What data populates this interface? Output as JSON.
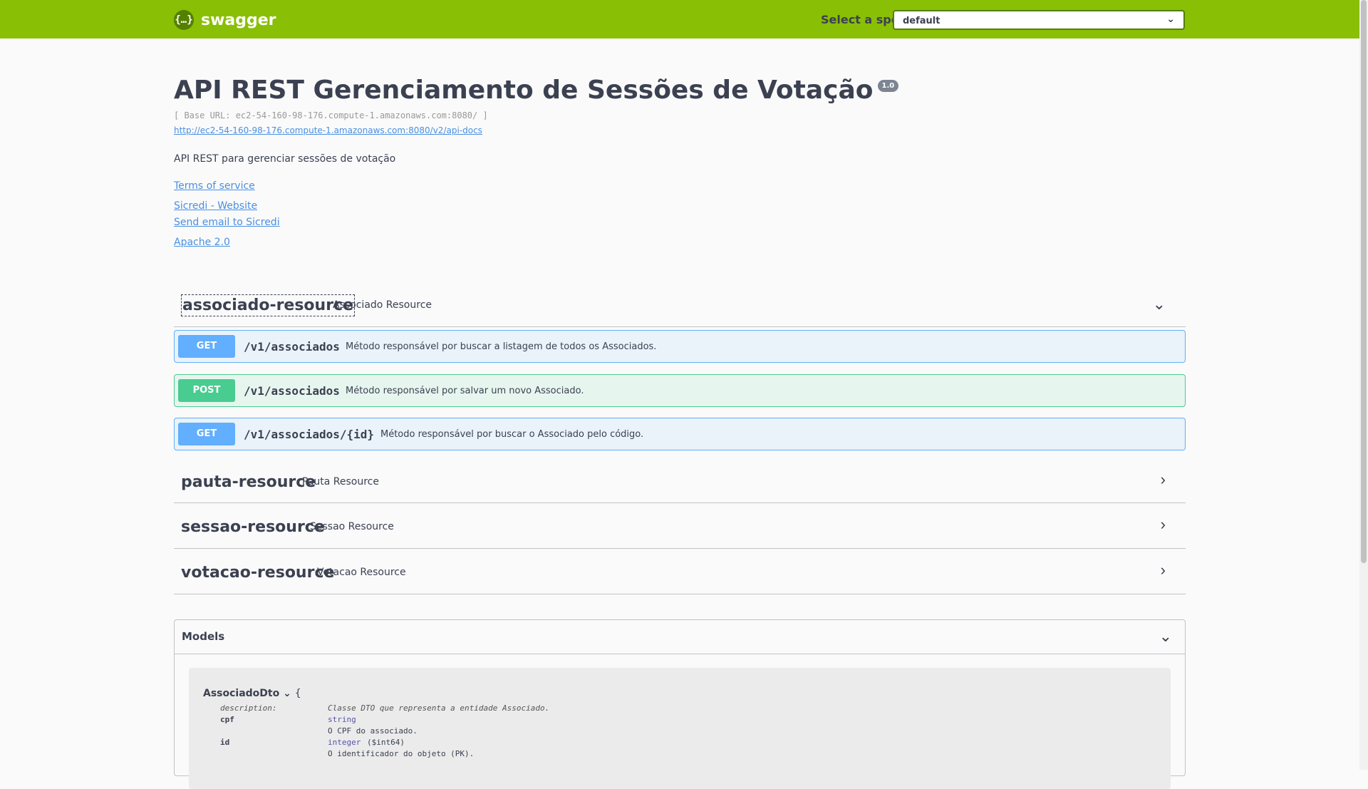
{
  "header": {
    "logo_glyph": "{…}",
    "logo_text": "swagger",
    "spec_label": "Select a spec",
    "spec_value": "default"
  },
  "info": {
    "title": "API REST Gerenciamento de Sessões de Votação",
    "version": "1.0",
    "base_url": "[ Base URL: ec2-54-160-98-176.compute-1.amazonaws.com:8080/ ]",
    "docs_link": "http://ec2-54-160-98-176.compute-1.amazonaws.com:8080/v2/api-docs",
    "description": "API REST para gerenciar sessões de votação",
    "terms": "Terms of service",
    "website": "Sicredi - Website",
    "email": "Send email to Sicredi",
    "license": "Apache 2.0"
  },
  "tags": [
    {
      "name": "associado-resource",
      "description": "Associado Resource",
      "expanded": true,
      "operations": [
        {
          "method": "GET",
          "path": "/v1/associados",
          "summary": "Método responsável por buscar a listagem de todos os Associados."
        },
        {
          "method": "POST",
          "path": "/v1/associados",
          "summary": "Método responsável por salvar um novo Associado."
        },
        {
          "method": "GET",
          "path": "/v1/associados/{id}",
          "summary": "Método responsável por buscar o Associado pelo código."
        }
      ]
    },
    {
      "name": "pauta-resource",
      "description": "Pauta Resource",
      "expanded": false
    },
    {
      "name": "sessao-resource",
      "description": "Sessao Resource",
      "expanded": false
    },
    {
      "name": "votacao-resource",
      "description": "Votacao Resource",
      "expanded": false
    }
  ],
  "models": {
    "title": "Models",
    "model": {
      "name": "AssociadoDto",
      "brace": "{",
      "description_key": "description:",
      "description_value": "Classe DTO que representa a entidade Associado.",
      "fields": [
        {
          "name": "cpf",
          "type": "string",
          "format": "",
          "description": "O CPF do associado."
        },
        {
          "name": "id",
          "type": "integer",
          "format": "($int64)",
          "description": "O identificador do objeto (PK)."
        }
      ]
    }
  },
  "icons": {
    "expand": "chevron-down-icon",
    "collapsed": "chevron-right-icon"
  }
}
